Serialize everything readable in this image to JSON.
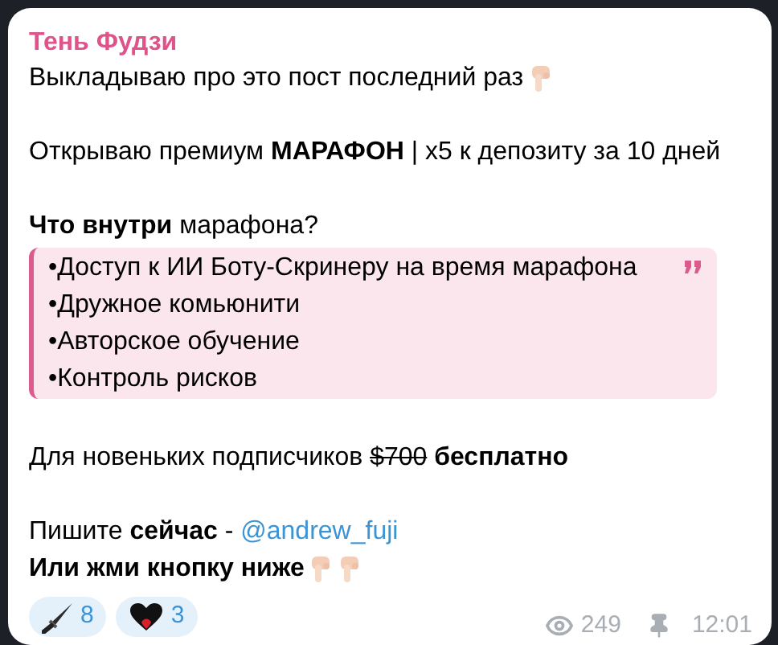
{
  "author": "Тень Фудзи",
  "blocks": [
    {
      "kind": "text",
      "segments": [
        {
          "kind": "plain",
          "text": "Выкладываю про это пост последний раз"
        },
        {
          "kind": "icon"
        }
      ]
    },
    {
      "kind": "blank"
    },
    {
      "kind": "text",
      "segments": [
        {
          "kind": "plain",
          "text": "Открываю премиум "
        },
        {
          "kind": "bold",
          "text": "МАРАФОН"
        },
        {
          "kind": "plain",
          "text": " | x5 к депозиту за 10 дней"
        }
      ]
    },
    {
      "kind": "blank"
    },
    {
      "kind": "text",
      "segments": [
        {
          "kind": "bold",
          "text": "Что внутри"
        },
        {
          "kind": "plain",
          "text": " марафона?"
        }
      ]
    },
    {
      "kind": "quote",
      "items": [
        "•Доступ к ИИ Боту-Скринеру на время марафона",
        "•Дружное комьюнити",
        "•Авторское обучение",
        "•Контроль рисков"
      ]
    },
    {
      "kind": "blank"
    },
    {
      "kind": "text",
      "segments": [
        {
          "kind": "plain",
          "text": "Для новеньких подписчиков "
        },
        {
          "kind": "strike",
          "text": "$700"
        },
        {
          "kind": "bold",
          "text": " бесплатно"
        }
      ]
    },
    {
      "kind": "blank"
    },
    {
      "kind": "text",
      "segments": [
        {
          "kind": "plain",
          "text": "Пишите "
        },
        {
          "kind": "bold",
          "text": "сейчас"
        },
        {
          "kind": "plain",
          "text": " - "
        },
        {
          "kind": "link",
          "text": "@andrew_fuji"
        }
      ]
    },
    {
      "kind": "text",
      "segments": [
        {
          "kind": "bold",
          "text": "Или жми кнопку ниже"
        },
        {
          "kind": "icon"
        },
        {
          "kind": "icon"
        }
      ]
    }
  ],
  "reactions": [
    {
      "kind": "sword",
      "count": "8"
    },
    {
      "kind": "heart",
      "count": "3"
    }
  ],
  "views": "249",
  "pinned": true,
  "time": "12:01"
}
